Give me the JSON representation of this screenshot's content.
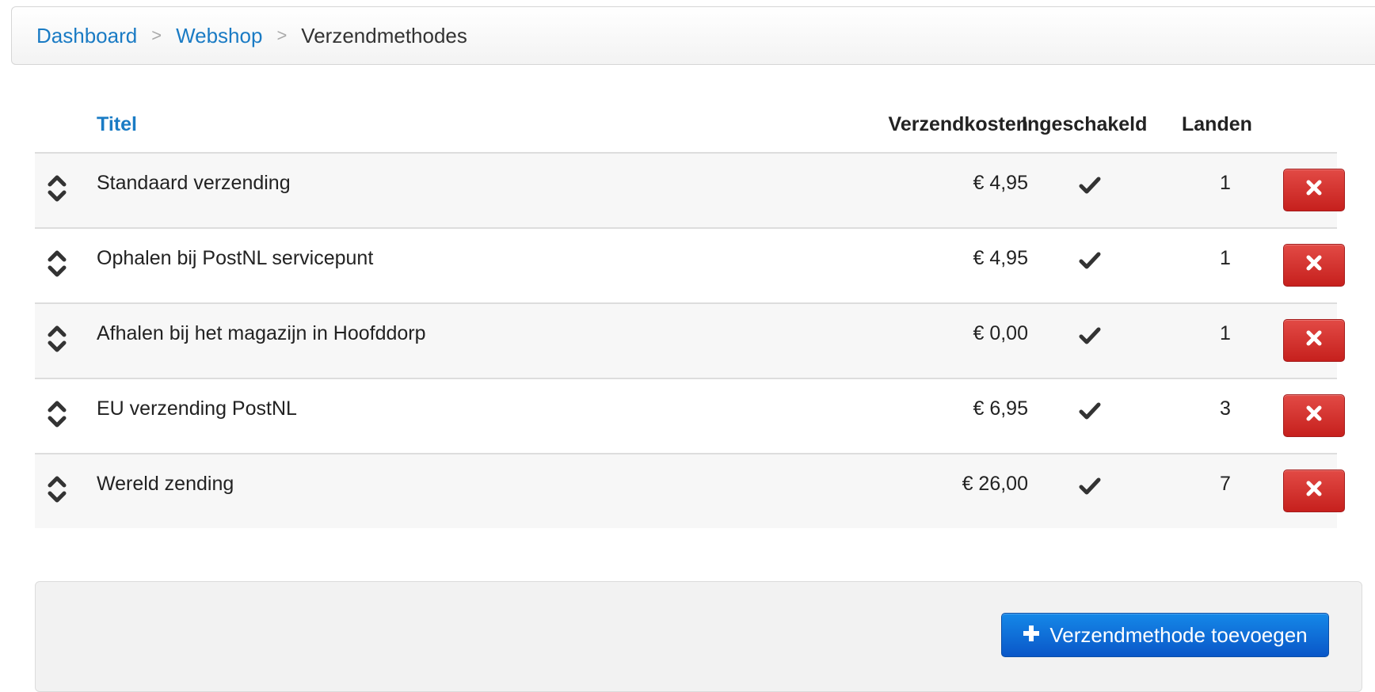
{
  "breadcrumb": {
    "items": [
      {
        "label": "Dashboard"
      },
      {
        "label": "Webshop"
      }
    ],
    "separator": ">",
    "current": "Verzendmethodes"
  },
  "table": {
    "headers": {
      "title": "Titel",
      "cost": "Verzendkosten",
      "enabled": "Ingeschakeld",
      "countries": "Landen"
    },
    "rows": [
      {
        "title": "Standaard verzending",
        "cost": "€ 4,95",
        "enabled": true,
        "countries": "1"
      },
      {
        "title": "Ophalen bij PostNL servicepunt",
        "cost": "€ 4,95",
        "enabled": true,
        "countries": "1"
      },
      {
        "title": "Afhalen bij het magazijn in Hoofddorp",
        "cost": "€ 0,00",
        "enabled": true,
        "countries": "1"
      },
      {
        "title": "EU verzending PostNL",
        "cost": "€ 6,95",
        "enabled": true,
        "countries": "3"
      },
      {
        "title": "Wereld zending",
        "cost": "€ 26,00",
        "enabled": true,
        "countries": "7"
      }
    ],
    "icons": {
      "drag": "sort-handle-icon",
      "check": "checkmark-icon",
      "delete": "close-icon"
    }
  },
  "footer": {
    "add_button_label": "Verzendmethode toevoegen",
    "add_icon": "plus-icon"
  },
  "colors": {
    "link": "#1a7bc4",
    "danger": "#c6201d",
    "primary": "#0a57c8"
  }
}
